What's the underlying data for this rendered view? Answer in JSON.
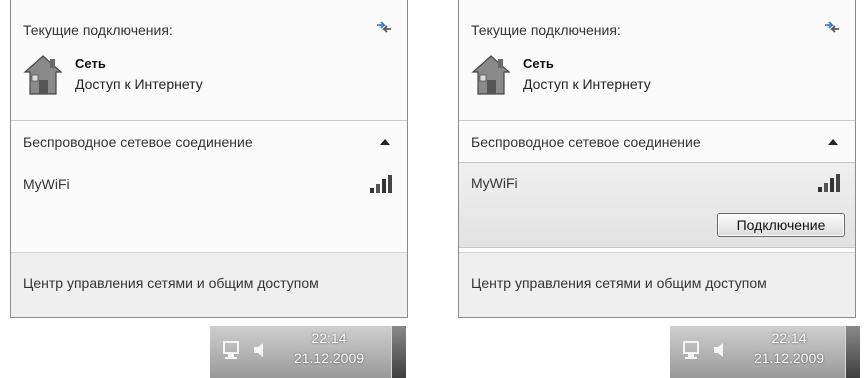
{
  "left": {
    "current_connections_title": "Текущие подключения:",
    "network_name": "Сеть",
    "network_status": "Доступ к Интернету",
    "wireless_section_title": "Беспроводное сетевое соединение",
    "wifi_name": "MyWiFi",
    "center_link": "Центр управления сетями и общим доступом",
    "time": "22:14",
    "date": "21.12.2009"
  },
  "right": {
    "current_connections_title": "Текущие подключения:",
    "network_name": "Сеть",
    "network_status": "Доступ к Интернету",
    "wireless_section_title": "Беспроводное сетевое соединение",
    "wifi_name": "MyWiFi",
    "connect_button": "Подключение",
    "center_link": "Центр управления сетями и общим доступом",
    "time": "22:14",
    "date": "21.12.2009"
  },
  "icons": {
    "refresh": "refresh-icon",
    "network": "house-network-icon",
    "collapse": "chevron-up-icon",
    "signal": "wifi-signal-icon",
    "tray_network": "tray-network-icon",
    "tray_sound": "speaker-icon"
  }
}
